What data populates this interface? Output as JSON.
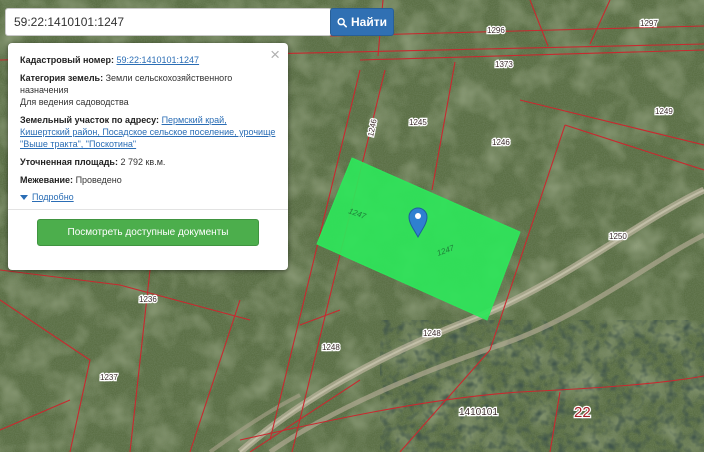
{
  "search": {
    "value": "59:22:1410101:1247",
    "button_label": "Найти",
    "button_icon": "search-icon"
  },
  "popup": {
    "close_label": "×",
    "cadastral_label": "Кадастровый номер:",
    "cadastral_value": "59:22:1410101:1247",
    "category_label": "Категория земель:",
    "category_value": "Земли сельскохозяйственного назначения",
    "use_value": "Для ведения садоводства",
    "address_label": "Земельный участок по адресу:",
    "address_value": "Пермский край, Кишертский район, Посадское сельское поселение, урочище \"Выше тракта\", \"Поскотина\"",
    "area_label": "Уточненная площадь:",
    "area_value": "2 792 кв.м.",
    "survey_label": "Межевание:",
    "survey_value": "Проведено",
    "details_label": "Подробно",
    "docs_button_label": "Посмотреть доступные документы"
  },
  "map": {
    "parcel_labels": [
      "1297",
      "1296",
      "1373",
      "1249",
      "1245",
      "1246",
      "1246",
      "1247",
      "1247",
      "1250",
      "1236",
      "1248",
      "1248",
      "1237",
      "1410101",
      "22"
    ],
    "highlight_color": "#2ee65a",
    "boundary_color": "#c8292f",
    "marker_color": "#2f80d0"
  }
}
